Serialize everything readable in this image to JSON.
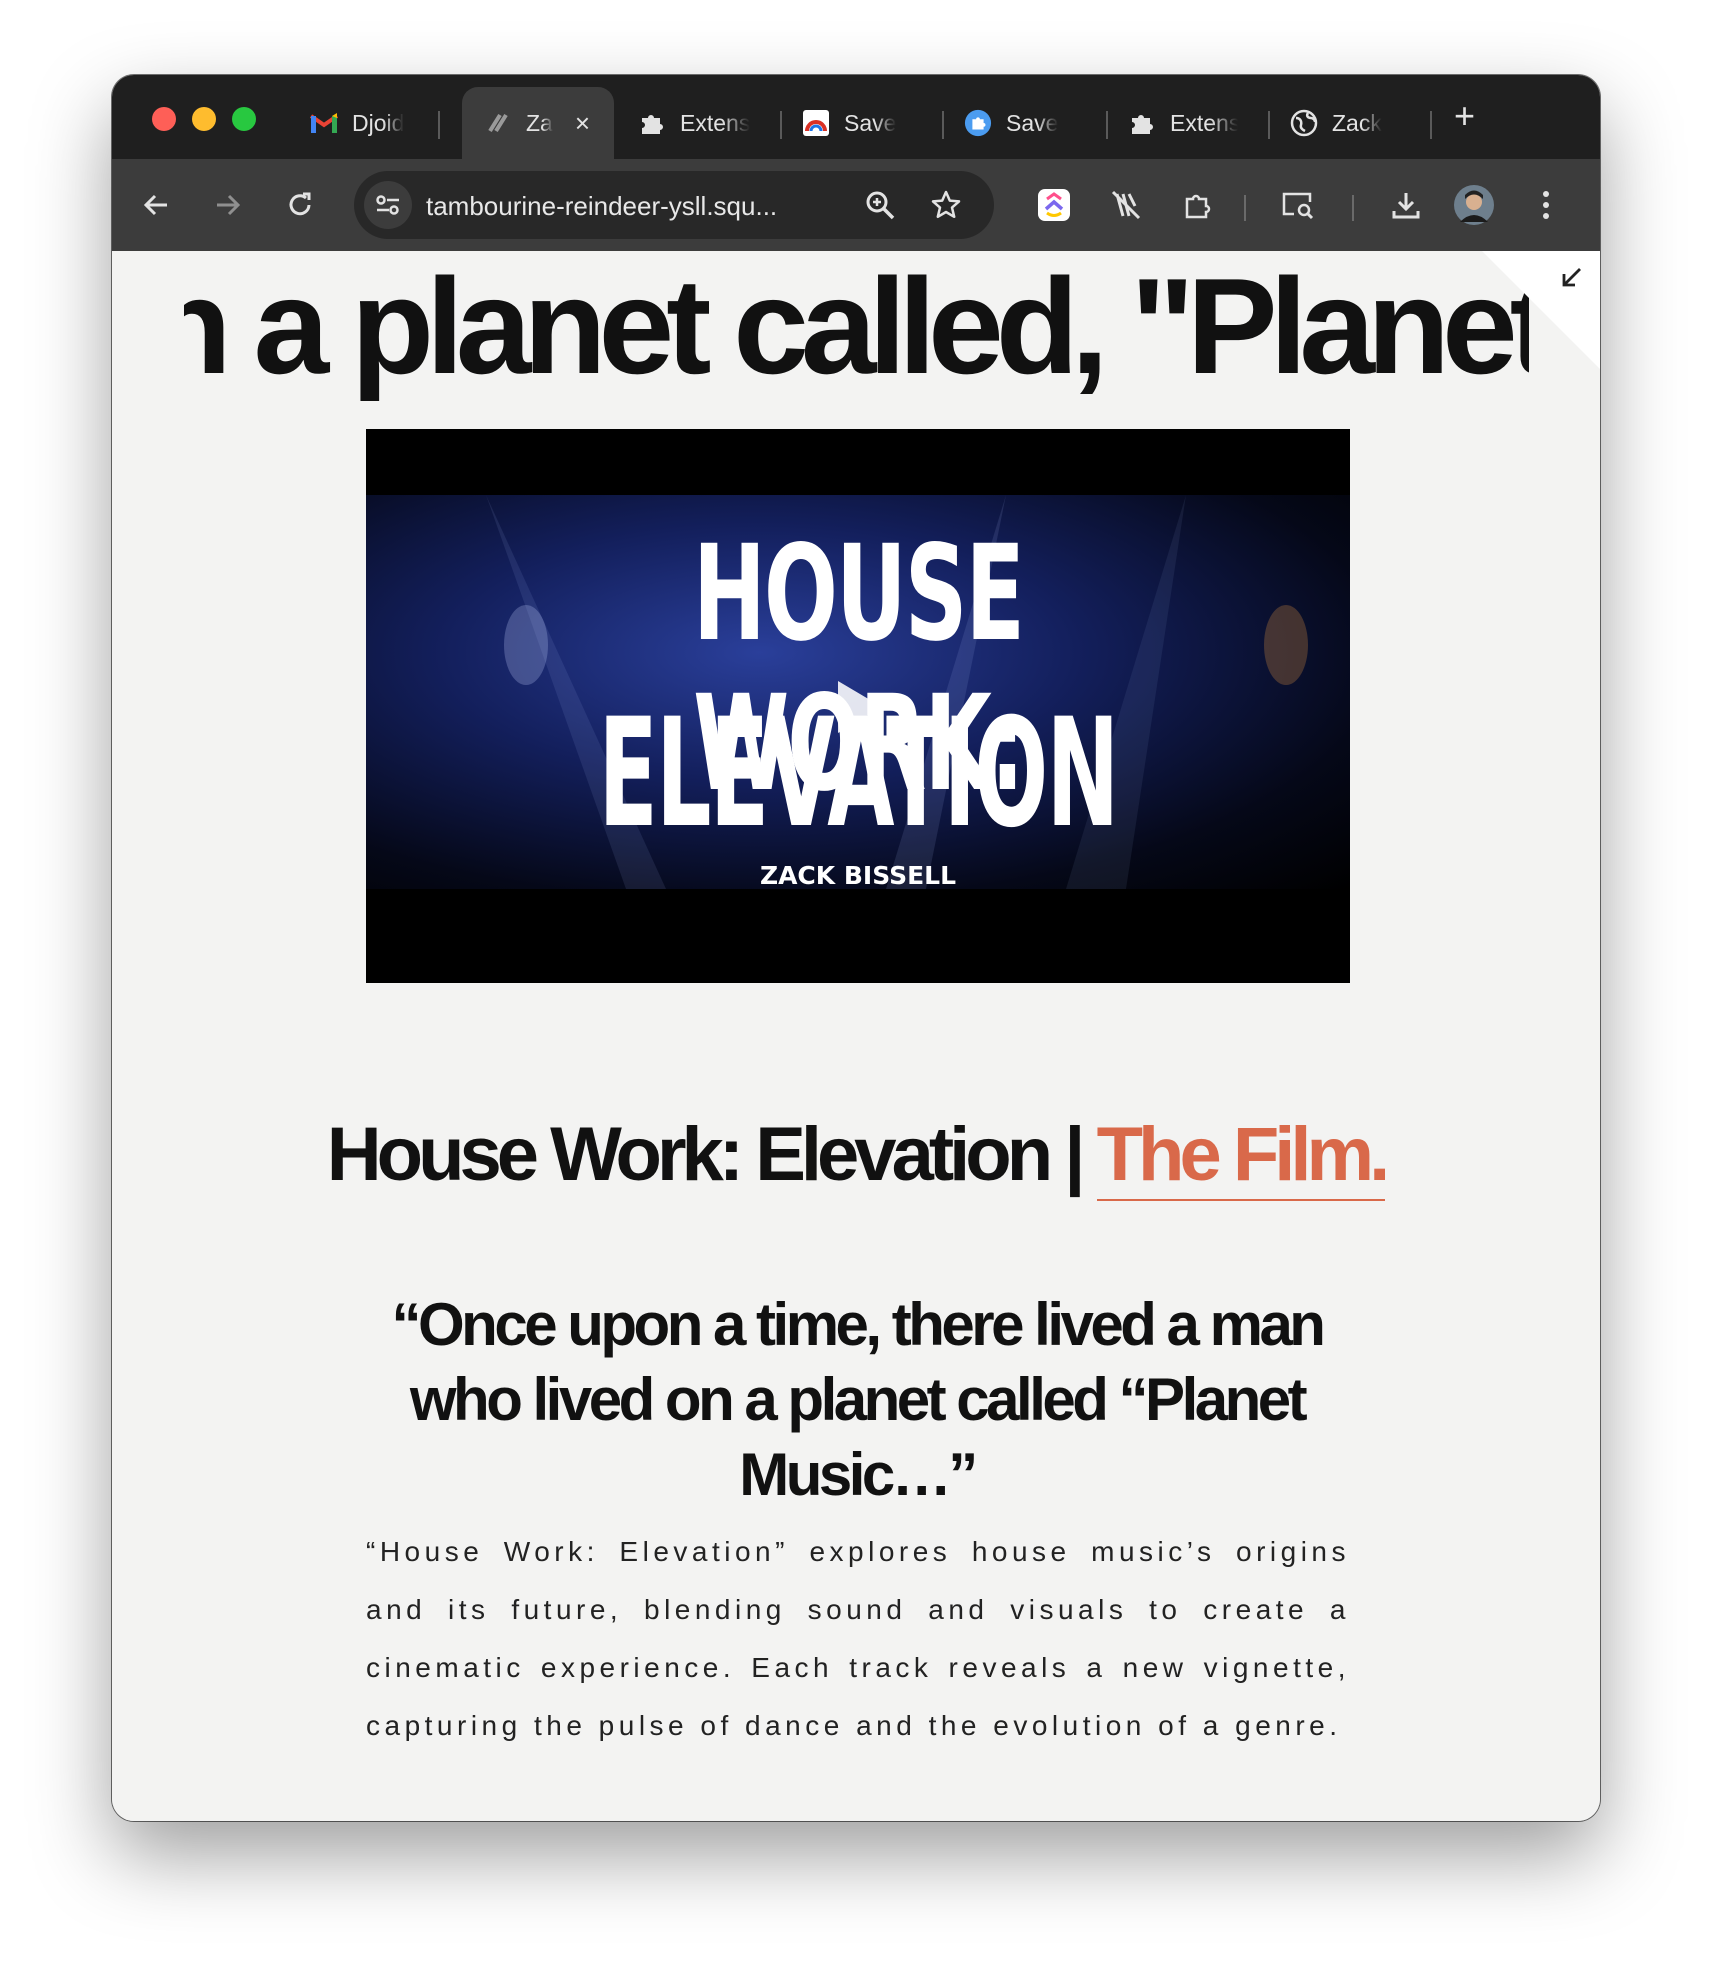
{
  "browser": {
    "tabs": [
      {
        "title": "Djoid",
        "icon": "gmail-icon",
        "active": false
      },
      {
        "title": "Za",
        "icon": "squarespace-icon",
        "active": true
      },
      {
        "title": "Extens",
        "icon": "puzzle-icon",
        "active": false
      },
      {
        "title": "Save",
        "icon": "save-app-icon",
        "active": false
      },
      {
        "title": "Save",
        "icon": "blue-puzzle-icon",
        "active": false
      },
      {
        "title": "Extens",
        "icon": "puzzle-icon",
        "active": false
      },
      {
        "title": "Zack",
        "icon": "globe-icon",
        "active": false
      }
    ],
    "new_tab_label": "+",
    "close_label": "×",
    "url": "tambourine-reindeer-ysll.squ..."
  },
  "page": {
    "marquee": "n a planet called, \"Planet",
    "video": {
      "title_line1": "HOUSE WORK:",
      "title_line2": "ELEVATION",
      "credit": "ZACK BISSELL"
    },
    "heading_main": "House Work: Elevation | ",
    "heading_link": "The Film.",
    "quote": "“Once upon a time, there lived a man who lived on a planet called “Planet Music…”",
    "description": "“House Work: Elevation” explores house music’s origins and its future, blending sound and visuals to create a cinematic experience. Each track reveals a new vignette, capturing the pulse of dance and the evolution of a genre."
  },
  "colors": {
    "accent": "#d9694a",
    "page_bg": "#f3f3f2",
    "chrome_dark": "#1f1f1f",
    "toolbar": "#3c3c3c"
  }
}
